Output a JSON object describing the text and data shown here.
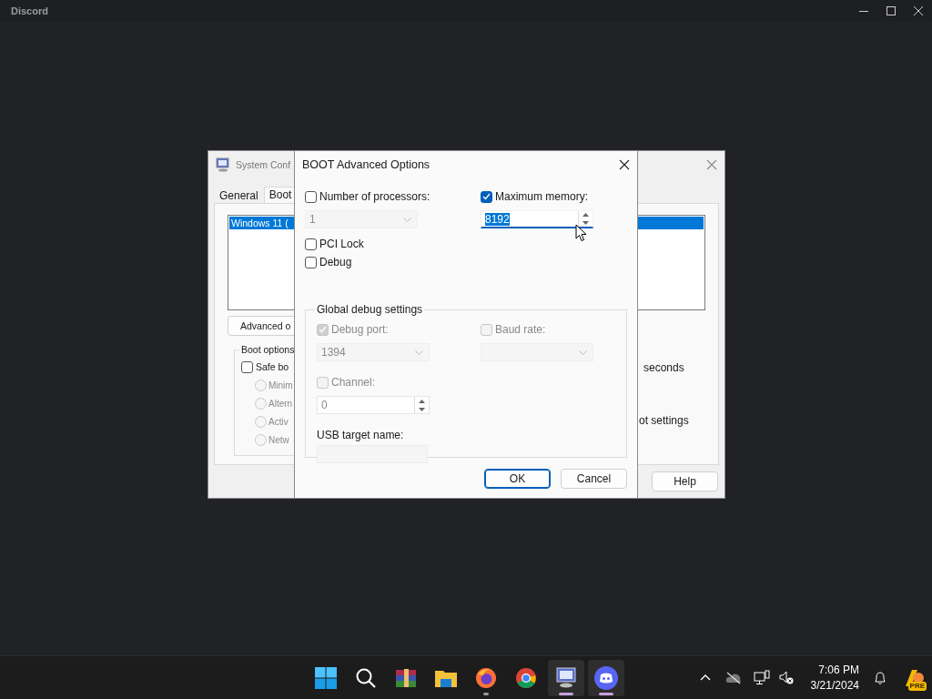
{
  "app_bar": {
    "title": "Discord"
  },
  "background_window": {
    "title": "System Conf",
    "tabs": [
      {
        "label": "General",
        "selected": false
      },
      {
        "label": "Boot",
        "selected": true
      }
    ],
    "boot_list": [
      {
        "label": "Windows 11 (",
        "selected": true
      }
    ],
    "advanced_button": "Advanced o",
    "boot_options": {
      "title": "Boot options",
      "safe_boot": {
        "label": "Safe bo",
        "checked": false
      },
      "modes": [
        {
          "label": "Minim",
          "selected": false
        },
        {
          "label": "Altern",
          "selected": false
        },
        {
          "label": "Activ",
          "selected": false
        },
        {
          "label": "Netw",
          "selected": false
        }
      ]
    },
    "timeout_unit": "seconds",
    "persist_label": "ot settings",
    "help_button": "Help"
  },
  "dialog": {
    "title": "BOOT Advanced Options",
    "processors": {
      "label": "Number of processors:",
      "checked": false,
      "value": "1"
    },
    "max_memory": {
      "label": "Maximum memory:",
      "checked": true,
      "value": "8192",
      "focused": true
    },
    "options": [
      {
        "label": "PCI Lock",
        "checked": false
      },
      {
        "label": "Debug",
        "checked": false
      }
    ],
    "debug_settings": {
      "title": "Global debug settings",
      "debug_port": {
        "label": "Debug port:",
        "checked": true,
        "disabled": true,
        "value": "1394"
      },
      "baud_rate": {
        "label": "Baud rate:",
        "checked": false,
        "disabled": true
      },
      "channel": {
        "label": "Channel:",
        "checked": false,
        "disabled": true,
        "value": "0"
      },
      "usb_target": {
        "label": "USB target name:"
      }
    },
    "buttons": [
      {
        "label": "OK",
        "default": true
      },
      {
        "label": "Cancel",
        "default": false
      }
    ]
  },
  "taskbar": {
    "apps": [
      {
        "kind": "start",
        "running": false,
        "active": false
      },
      {
        "kind": "search",
        "running": false,
        "active": false
      },
      {
        "kind": "archiver",
        "running": false,
        "active": false
      },
      {
        "kind": "folder",
        "running": false,
        "active": false
      },
      {
        "kind": "firefox",
        "running": true,
        "active": false
      },
      {
        "kind": "chrome",
        "running": false,
        "active": false
      },
      {
        "kind": "msconfig",
        "running": true,
        "active": true
      },
      {
        "kind": "discord",
        "running": true,
        "active": true
      }
    ],
    "time": "7:06 PM",
    "date": "3/21/2024",
    "badge": "PRE"
  }
}
